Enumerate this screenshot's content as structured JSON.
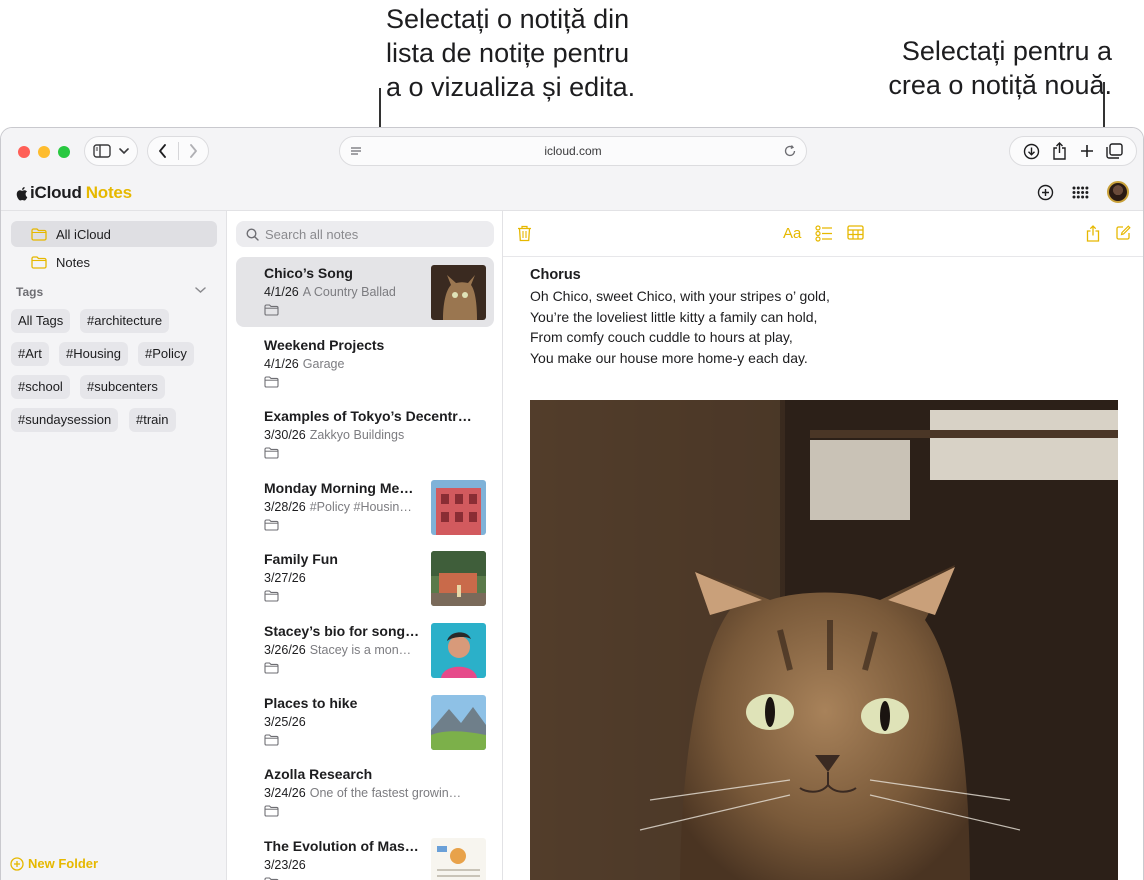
{
  "callouts": {
    "left": [
      "Selectați o notiță din",
      "lista de notițe pentru",
      "a o vizualiza și edita."
    ],
    "right": [
      "Selectați pentru a",
      "crea o notiță nouă."
    ]
  },
  "browser": {
    "url": "icloud.com",
    "toolbar_icons": [
      "sidebar-icon",
      "chevron-down-icon",
      "back-icon",
      "forward-icon",
      "reader-icon",
      "reload-icon",
      "download-icon",
      "share-icon",
      "new-tab-icon",
      "tabs-overview-icon"
    ]
  },
  "app": {
    "brand_icloud": "iCloud",
    "brand_notes": "Notes",
    "header_icons": [
      "add-icon",
      "app-grid-icon",
      "avatar"
    ],
    "accent_color": "#e6b800"
  },
  "sidebar": {
    "folders": [
      {
        "label": "All iCloud",
        "selected": true
      },
      {
        "label": "Notes",
        "selected": false
      }
    ],
    "tags_header": "Tags",
    "tags": [
      "All Tags",
      "#architecture",
      "#Art",
      "#Housing",
      "#Policy",
      "#school",
      "#subcenters",
      "#sundaysession",
      "#train"
    ],
    "new_folder": "New Folder"
  },
  "notelist": {
    "search_placeholder": "Search all notes",
    "notes": [
      {
        "title": "Chico’s Song",
        "date": "4/1/26",
        "preview": "A Country Ballad",
        "thumb": "cat",
        "selected": true
      },
      {
        "title": "Weekend Projects",
        "date": "4/1/26",
        "preview": "Garage",
        "thumb": null
      },
      {
        "title": "Examples of Tokyo’s Decentr…",
        "date": "3/30/26",
        "preview": "Zakkyo Buildings",
        "thumb": null
      },
      {
        "title": "Monday Morning Me…",
        "date": "3/28/26",
        "preview": "#Policy #Housin…",
        "thumb": "pink-building"
      },
      {
        "title": "Family Fun",
        "date": "3/27/26",
        "preview": "",
        "thumb": "garden"
      },
      {
        "title": "Stacey’s bio for song…",
        "date": "3/26/26",
        "preview": "Stacey is a mon…",
        "thumb": "portrait"
      },
      {
        "title": "Places to hike",
        "date": "3/25/26",
        "preview": "",
        "thumb": "mountains"
      },
      {
        "title": "Azolla Research",
        "date": "3/24/26",
        "preview": "One of the fastest growin…",
        "thumb": null
      },
      {
        "title": "The Evolution of Mas…",
        "date": "3/23/26",
        "preview": "",
        "thumb": "document"
      }
    ]
  },
  "editor": {
    "toolbar_icons": [
      "trash-icon",
      "format-text-icon",
      "checklist-icon",
      "table-icon",
      "share-icon",
      "compose-icon"
    ],
    "format_label": "Aa",
    "heading": "Chorus",
    "lines": [
      "Oh Chico, sweet Chico, with your stripes o’ gold,",
      "You’re the loveliest little kitty a family can hold,",
      "From comfy couch cuddle to hours at play,",
      "You make our house more home-y each day."
    ],
    "image": "cat-photo"
  }
}
